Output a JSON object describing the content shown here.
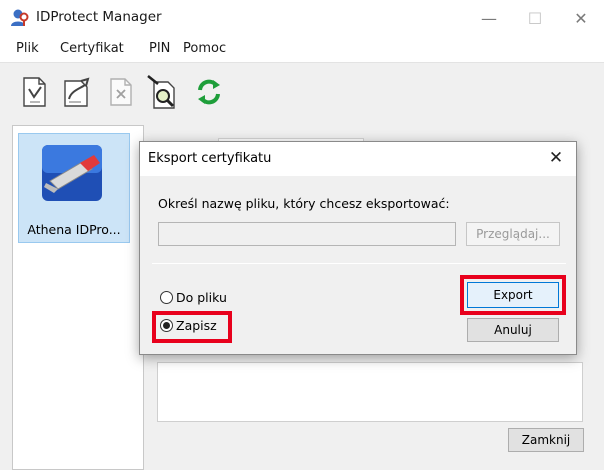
{
  "window": {
    "title": "IDProtect Manager",
    "controls": {
      "minimize": "—",
      "maximize": "☐",
      "close": "✕"
    }
  },
  "menu": [
    "Plik",
    "Certyfikat",
    "PIN",
    "Pomoc"
  ],
  "toolbar": {
    "icons": [
      "import-certificate-icon",
      "export-certificate-icon",
      "delete-certificate-icon",
      "view-certificate-icon",
      "refresh-icon"
    ]
  },
  "devices": [
    {
      "label": "Athena IDPro...",
      "icon": "usb-token-icon",
      "selected": true
    }
  ],
  "main": {
    "close_button": "Zamknij"
  },
  "dialog": {
    "title": "Eksport certyfikatu",
    "close_glyph": "✕",
    "prompt": "Określ nazwę pliku, który chcesz eksportować:",
    "file_path_value": "",
    "browse_button": "Przeglądaj...",
    "options": [
      {
        "label": "Do pliku",
        "checked": false
      },
      {
        "label": "Zapisz",
        "checked": true
      }
    ],
    "export_button": "Export",
    "cancel_button": "Anuluj"
  },
  "colors": {
    "highlight": "#e8001c",
    "selection": "#cce4f7",
    "default_button_border": "#0078d7",
    "refresh_green": "#1e9e3a"
  }
}
